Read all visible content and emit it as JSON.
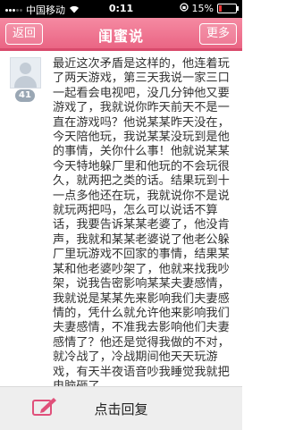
{
  "status_bar": {
    "carrier": "中国移动",
    "time": "0:11",
    "battery": "15%",
    "battery_level": 0.15
  },
  "header": {
    "back_label": "返回",
    "title": "闺蜜说",
    "more_label": "更多"
  },
  "post": {
    "avatar_badge": "41",
    "text": "最近这次矛盾是这样的，他连着玩了两天游戏，第三天我说一家三口一起看会电视吧，没几分钟他又要游戏了，我就说你昨天前天不是一直在游戏吗？他说某某昨天没在，今天陪他玩，我说某某没玩到是他的事情，关你什么事！他就说某某今天特地躲厂里和他玩的不会玩很久，就两把之类的话。结果玩到十一点多他还在玩，我就说你不是说就玩两把吗，怎么可以说话不算话，我要告诉某某老婆了，他没肯声，我就和某某老婆说了他老公躲厂里玩游戏不回家的事情，结果某某和他老婆吵架了，他就来找我吵架，说我告密影响某某夫妻感情，我就说是某某先来影响我们夫妻感情的，凭什么就允许他来影响我们夫妻感情，不准我去影响他们夫妻感情了？他还是觉得我做的不对，就冷战了，冷战期间他天天玩游戏，有天半夜语音吵我睡觉我就把电脑砸了"
  },
  "footer": {
    "reply_label": "点击回复"
  },
  "colors": {
    "header_pink": "#ea6584",
    "reply_icon": "#e0507a"
  }
}
